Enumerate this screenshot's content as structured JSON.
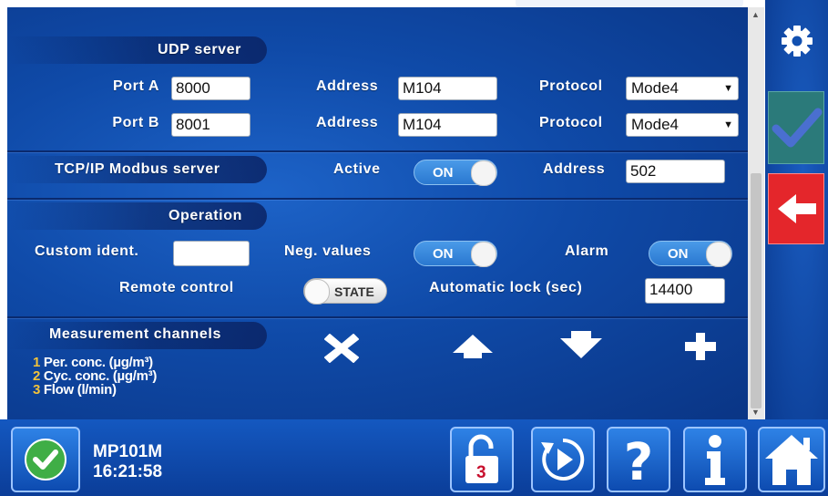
{
  "udp": {
    "title": "UDP server",
    "port_a_label": "Port A",
    "port_a_value": "8000",
    "port_b_label": "Port B",
    "port_b_value": "8001",
    "address_label": "Address",
    "address_a_value": "M104",
    "address_b_value": "M104",
    "protocol_label": "Protocol",
    "protocol_a_value": "Mode4",
    "protocol_b_value": "Mode4"
  },
  "tcp": {
    "title": "TCP/IP Modbus server",
    "active_label": "Active",
    "active_value": "ON",
    "address_label": "Address",
    "address_value": "502"
  },
  "operation": {
    "title": "Operation",
    "custom_ident_label": "Custom ident.",
    "custom_ident_value": "",
    "neg_values_label": "Neg. values",
    "neg_values_value": "ON",
    "alarm_label": "Alarm",
    "alarm_value": "ON",
    "remote_control_label": "Remote control",
    "remote_control_value": "STATE",
    "auto_lock_label": "Automatic lock (sec)",
    "auto_lock_value": "14400"
  },
  "channels": {
    "title": "Measurement channels",
    "items": [
      {
        "num": "1",
        "label": "Per. conc. (µg/m³)"
      },
      {
        "num": "2",
        "label": "Cyc. conc. (µg/m³)"
      },
      {
        "num": "3",
        "label": "Flow (l/min)"
      }
    ],
    "tools": [
      "delete-icon",
      "arrow-up-icon",
      "arrow-down-icon",
      "plus-icon"
    ]
  },
  "device": {
    "name": "MP101M",
    "time": "16:21:58"
  },
  "lock_level": "3",
  "colors": {
    "accent_blue": "#0f4aa8",
    "ok_green": "#3fae46",
    "cancel_red": "#e4262b",
    "check_teal": "#3a8a7a",
    "channel_number": "#f2c23a"
  }
}
